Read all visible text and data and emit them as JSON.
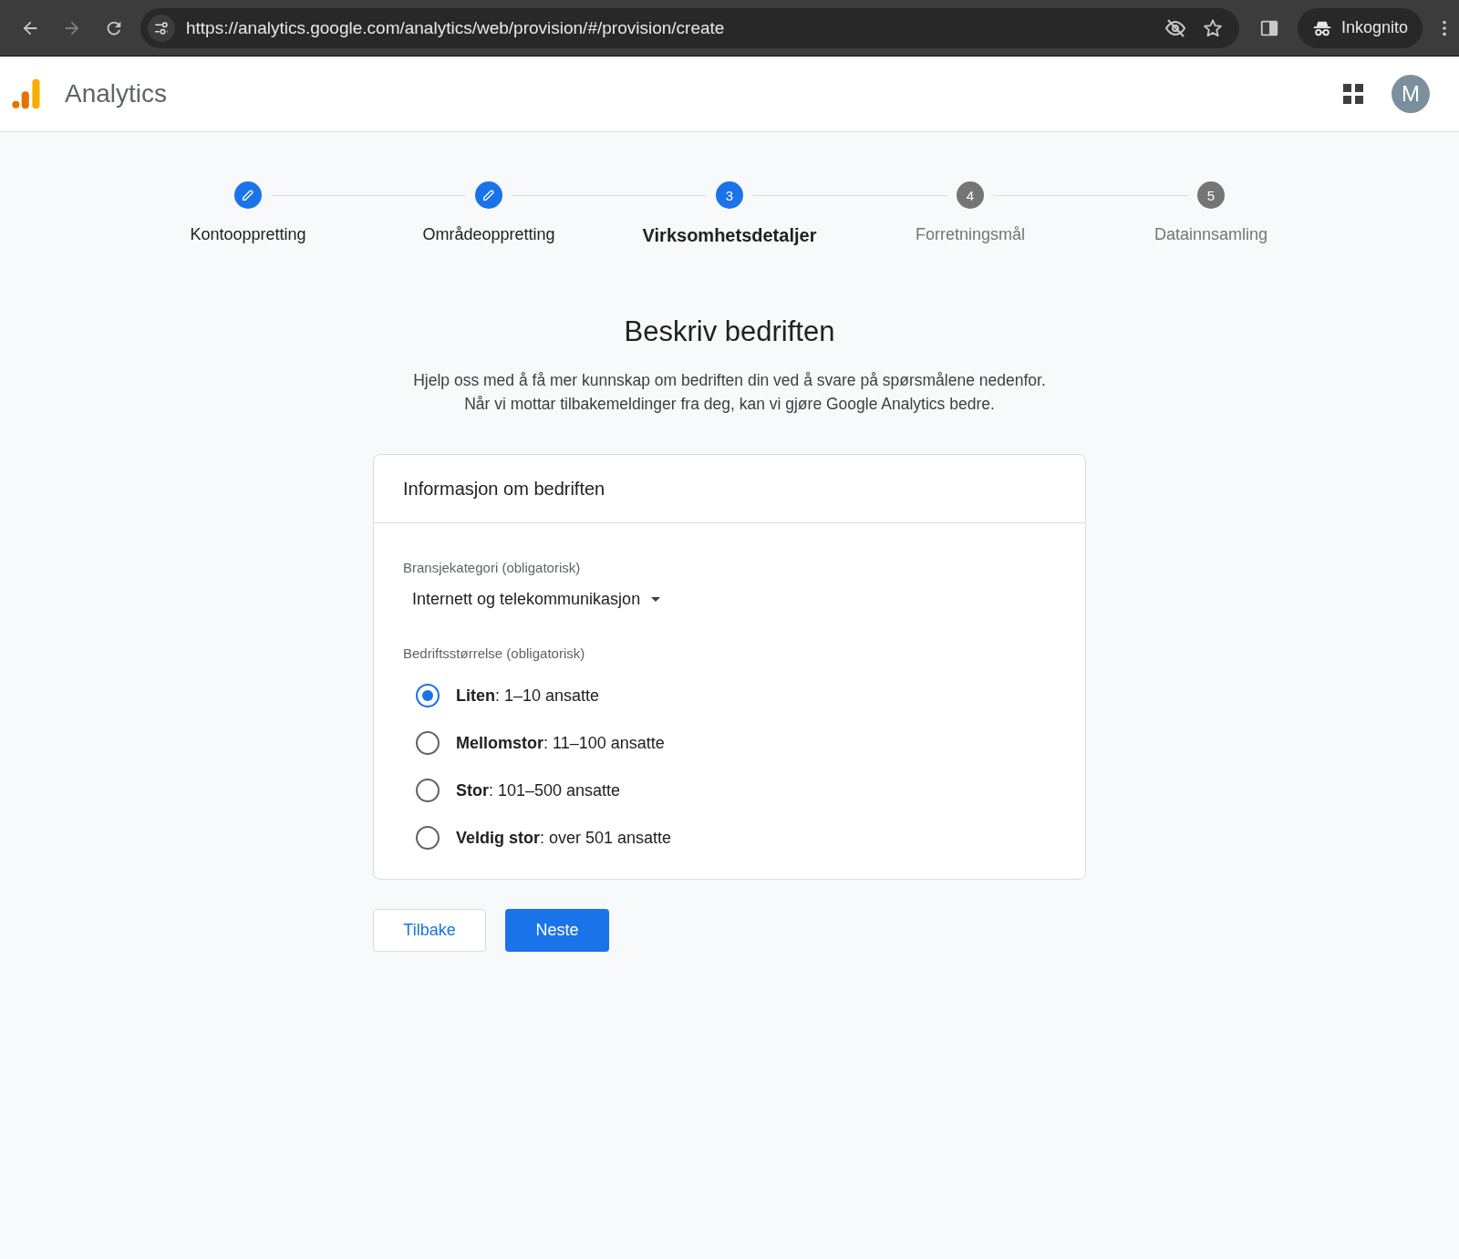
{
  "browser": {
    "url": "https://analytics.google.com/analytics/web/provision/#/provision/create",
    "profile": "Inkognito"
  },
  "app_bar": {
    "title": "Analytics",
    "avatar": "M"
  },
  "steps": [
    {
      "label": "Kontooppretting",
      "completed": true,
      "selected": false
    },
    {
      "label": "Områdeoppretting",
      "completed": true,
      "selected": false
    },
    {
      "label": "Virksomhetsdetaljer",
      "completed": false,
      "selected": true,
      "number": "3"
    },
    {
      "label": "Forretningsmål",
      "completed": false,
      "selected": false,
      "number": "4"
    },
    {
      "label": "Datainnsamling",
      "completed": false,
      "selected": false,
      "number": "5"
    }
  ],
  "heading": "Beskriv bedriften",
  "intro": [
    "Hjelp oss med å få mer kunnskap om bedriften din ved å svare på spørsmålene nedenfor.",
    "Når vi mottar tilbakemeldinger fra deg, kan vi gjøre Google Analytics bedre."
  ],
  "card": {
    "title": "Informasjon om bedriften",
    "category": {
      "label": "Bransjekategori (obligatorisk)",
      "value": "Internett og telekommunikasjon"
    },
    "size": {
      "label": "Bedriftsstørrelse (obligatorisk)",
      "options": [
        {
          "label": "**Liten**: 1–10 ansatte",
          "selected": true
        },
        {
          "label": "**Mellomstor**: 11–100 ansatte",
          "selected": false
        },
        {
          "label": "**Stor**: 101–500 ansatte",
          "selected": false
        },
        {
          "label": "**Veldig stor**: over 501 ansatte",
          "selected": false
        }
      ]
    }
  },
  "buttons": [
    {
      "label": "Tilbake",
      "kind": "secondary"
    },
    {
      "label": "Neste",
      "kind": "primary"
    }
  ]
}
